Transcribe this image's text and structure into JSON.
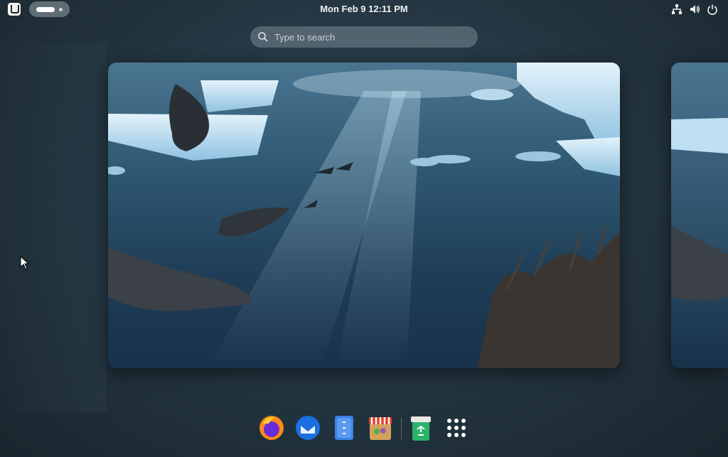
{
  "topbar": {
    "activities_icon": "ubuntu-activities-icon",
    "clock": "Mon Feb 9  12:11 PM",
    "tray_icons": [
      "network-icon",
      "volume-icon",
      "power-icon"
    ]
  },
  "search": {
    "placeholder": "Type to search",
    "value": ""
  },
  "windows": [
    {
      "name": "Underwater wallpaper window (center)"
    },
    {
      "name": "Underwater wallpaper window (right, partially visible)"
    }
  ],
  "dock": {
    "apps": [
      "Firefox",
      "Thunderbird",
      "Files",
      "App Center",
      "Trash",
      "Show Apps"
    ],
    "icons": [
      "firefox-icon",
      "thunderbird-icon",
      "files-icon",
      "app-center-icon",
      "trash-icon",
      "show-apps-icon"
    ]
  },
  "colors": {
    "topbar_text": "#f3f3f3",
    "water_dark": "#1f3b52",
    "water_light": "#4f7a94",
    "ice": "#cfe6f5",
    "accent_orange": "#e66000"
  }
}
